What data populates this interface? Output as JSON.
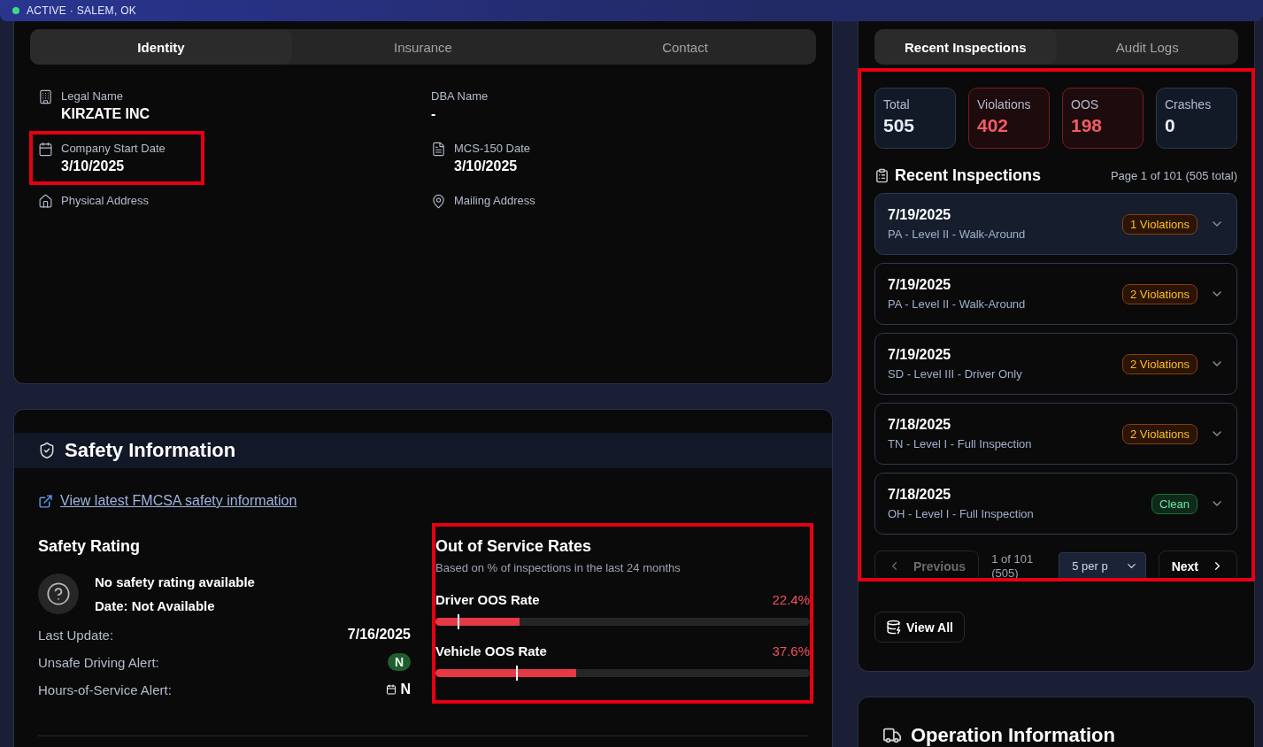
{
  "header": {
    "status": "ACTIVE · SALEM, OK",
    "active": true
  },
  "identity_card": {
    "tabs": [
      {
        "label": "Identity",
        "selected": true
      },
      {
        "label": "Insurance",
        "selected": false
      },
      {
        "label": "Contact",
        "selected": false
      }
    ],
    "fields": [
      {
        "label": "Legal Name",
        "value": "KIRZATE INC",
        "highlighted": false
      },
      {
        "label": "DBA Name",
        "value": "-",
        "highlighted": false
      },
      {
        "label": "Company Start Date",
        "value": "3/10/2025",
        "highlighted": true
      },
      {
        "label": "MCS-150 Date",
        "value": "3/10/2025",
        "highlighted": false
      },
      {
        "label": "Physical Address",
        "highlighted": false
      },
      {
        "label": "Mailing Address",
        "highlighted": false
      }
    ]
  },
  "safety_card": {
    "title": "Safety Information",
    "link": "View latest FMCSA safety information",
    "rating": {
      "title": "Safety Rating",
      "status": "No safety rating available",
      "date": "Date: Not Available"
    },
    "details": [
      {
        "label": "Last Update:",
        "value": "7/16/2025",
        "kind": "text"
      },
      {
        "label": "Unsafe Driving Alert:",
        "value": "N",
        "kind": "pill"
      },
      {
        "label": "Hours-of-Service Alert:",
        "value": "N",
        "kind": "dated"
      }
    ],
    "oos": {
      "title": "Out of Service Rates",
      "subtitle": "Based on % of inspections in the last 24 months",
      "highlighted": true,
      "rates": [
        {
          "name": "Driver OOS Rate",
          "reading": "22.4%",
          "level": 0.224,
          "marker": {
            "level": 0.06
          }
        },
        {
          "name": "Vehicle OOS Rate",
          "reading": "37.6%",
          "level": 0.376,
          "marker": {
            "level": 0.215
          }
        }
      ]
    }
  },
  "inspections_card": {
    "tabs": [
      {
        "label": "Recent Inspections",
        "selected": true
      },
      {
        "label": "Audit Logs",
        "selected": false
      }
    ],
    "highlighted": true,
    "stats": [
      {
        "label": "Total",
        "value": "505",
        "kind": "neutral"
      },
      {
        "label": "Violations",
        "value": "402",
        "kind": "alert"
      },
      {
        "label": "OOS",
        "value": "198",
        "kind": "alert"
      },
      {
        "label": "Crashes",
        "value": "0",
        "kind": "neutral"
      }
    ],
    "title": "Recent Inspections",
    "page_info": "Page 1 of 101 (505 total)",
    "items": [
      {
        "date": "7/19/2025",
        "detail": "PA - Level II - Walk-Around",
        "badge": "1 Violations",
        "kind": "violations",
        "selected": true
      },
      {
        "date": "7/19/2025",
        "detail": "PA - Level II - Walk-Around",
        "badge": "2 Violations",
        "kind": "violations",
        "selected": false
      },
      {
        "date": "7/19/2025",
        "detail": "SD - Level III - Driver Only",
        "badge": "2 Violations",
        "kind": "violations",
        "selected": false
      },
      {
        "date": "7/18/2025",
        "detail": "TN - Level I - Full Inspection",
        "badge": "2 Violations",
        "kind": "violations",
        "selected": false
      },
      {
        "date": "7/18/2025",
        "detail": "OH - Level I - Full Inspection",
        "badge": "Clean",
        "kind": "clean",
        "selected": false
      }
    ],
    "pagination": {
      "previous": "Previous",
      "previous_disabled": true,
      "page": "1 of 101",
      "total": "(505)",
      "per_page": "5 per p",
      "next": "Next"
    },
    "view_all": "View All"
  },
  "operation_card": {
    "title": "Operation Information"
  }
}
